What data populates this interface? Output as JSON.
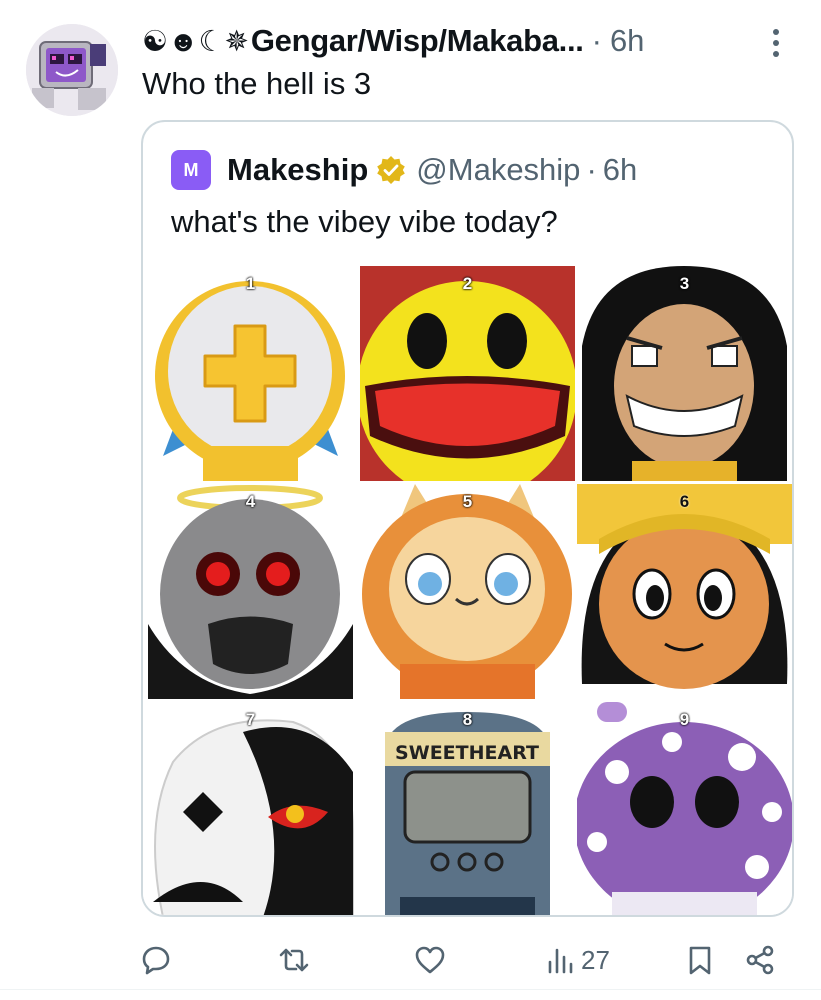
{
  "tweet": {
    "avatar_icon": "pixel-tv-character-avatar",
    "name_icons": "☯︎☻☾✵",
    "display_name": "Gengar/Wisp/Makaba...",
    "separator": "·",
    "time": "6h",
    "text": "Who the hell is 3",
    "menu_icon": "more-dots-icon"
  },
  "quote": {
    "logo_letter": "M",
    "name": "Makeship",
    "verified_icon": "gold-verified-badge-icon",
    "handle": "@Makeship",
    "separator": "·",
    "time": "6h",
    "text": "what's the vibey vibe today?",
    "grid": [
      {
        "number": "1",
        "icon": "white-helmet-yellow-cross-plush"
      },
      {
        "number": "2",
        "icon": "yellow-smiley-face-plush"
      },
      {
        "number": "3",
        "icon": "grinning-hooded-man-plush"
      },
      {
        "number": "4",
        "icon": "stitched-robot-red-eyes-plush"
      },
      {
        "number": "5",
        "icon": "orange-cat-hood-plush"
      },
      {
        "number": "6",
        "icon": "curly-haired-kid-plush"
      },
      {
        "number": "7",
        "icon": "white-black-ghost-plush"
      },
      {
        "number": "8",
        "icon": "phone-head-plush"
      },
      {
        "number": "8_label",
        "text": "SWEETHEART"
      },
      {
        "number": "9",
        "icon": "purple-mushroom-plush"
      }
    ]
  },
  "actions": {
    "reply_icon": "reply-icon",
    "retweet_icon": "retweet-icon",
    "like_icon": "heart-icon",
    "views_icon": "views-bar-chart-icon",
    "views_count": "27",
    "bookmark_icon": "bookmark-icon",
    "share_icon": "share-icon"
  },
  "colors": {
    "accent_purple": "#8a5cf5",
    "verified_gold": "#e2b719",
    "muted_text": "#536471",
    "border": "#cfd9de"
  }
}
